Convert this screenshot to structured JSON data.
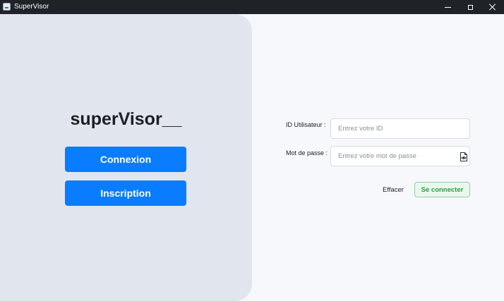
{
  "window": {
    "title": "SuperVisor",
    "icon": "app-icon"
  },
  "left_panel": {
    "brand": "superVisor__",
    "buttons": {
      "connexion": "Connexion",
      "inscription": "Inscription"
    }
  },
  "form": {
    "user_id": {
      "label": "ID Utilisateur :",
      "placeholder": "Entrez votre ID",
      "value": ""
    },
    "password": {
      "label": "Mot de passe :",
      "placeholder": "Entrez votre mot de passe",
      "value": "",
      "toggle_icon": "show-password-icon"
    },
    "clear_label": "Effacer",
    "login_label": "Se connecter"
  },
  "colors": {
    "titlebar": "#1f2328",
    "left_panel": "#e1e6ee",
    "primary_button": "#0a7cff",
    "login_text": "#2e9b47",
    "login_border": "#8fd19c",
    "login_background": "#eaf7ec"
  }
}
